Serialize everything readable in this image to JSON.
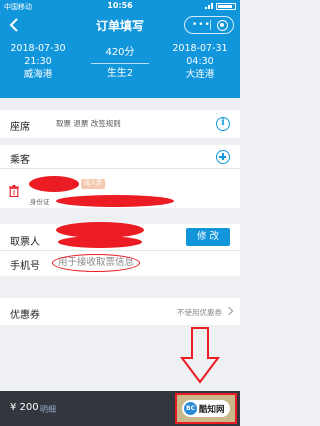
{
  "status_bar": {
    "carrier": "中国移动",
    "time": "10:56"
  },
  "nav": {
    "title": "订单填写",
    "capsule_dots": "•••"
  },
  "trip": {
    "departure": {
      "date": "2018-07-30",
      "time": "21:30",
      "station": "威海港"
    },
    "duration": "420分",
    "train": "生生2",
    "arrival": {
      "date": "2018-07-31",
      "time": "04:30",
      "station": "大连港"
    }
  },
  "seat": {
    "label": "座席",
    "sub": "取票 退票 改签规则",
    "info_glyph": "i"
  },
  "passenger": {
    "label": "乘客",
    "tag": "成人票",
    "id_label": "身份证"
  },
  "pickup": {
    "label": "取票人",
    "modify_label": "修 改",
    "phone_label": "手机号",
    "phone_placeholder": "用于接收取票信息"
  },
  "coupon": {
    "label": "优惠券",
    "value": "不使用优惠券"
  },
  "footer": {
    "price": "¥ 200",
    "details": "明细"
  },
  "brand": {
    "mark": "BC",
    "text": "酷知网"
  },
  "colors": {
    "primary": "#1196dc",
    "annotation": "#ec1c24",
    "footer_bg": "#33373d"
  }
}
